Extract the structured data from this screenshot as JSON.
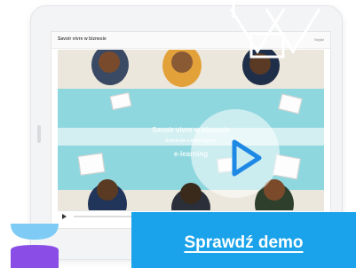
{
  "player": {
    "course_title": "Savoir vivre w biznesie",
    "exit_label": "Wyjdź",
    "overlay_title": "Savoir vivre w biznesie",
    "overlay_subtitle": "Szkolenie e-learningowe",
    "overlay_brand": "e-learning",
    "progress": 0.0
  },
  "cta": {
    "label": "Sprawdź demo"
  },
  "colors": {
    "cta": "#1aa3ea",
    "play_icon": "#1e88e5",
    "band": "#8fd7de",
    "logo_top": "#7ecbf5",
    "logo_bottom": "#8a4ee6"
  },
  "icons": {
    "play": "play-icon",
    "logo": "logo-mark-icon"
  }
}
